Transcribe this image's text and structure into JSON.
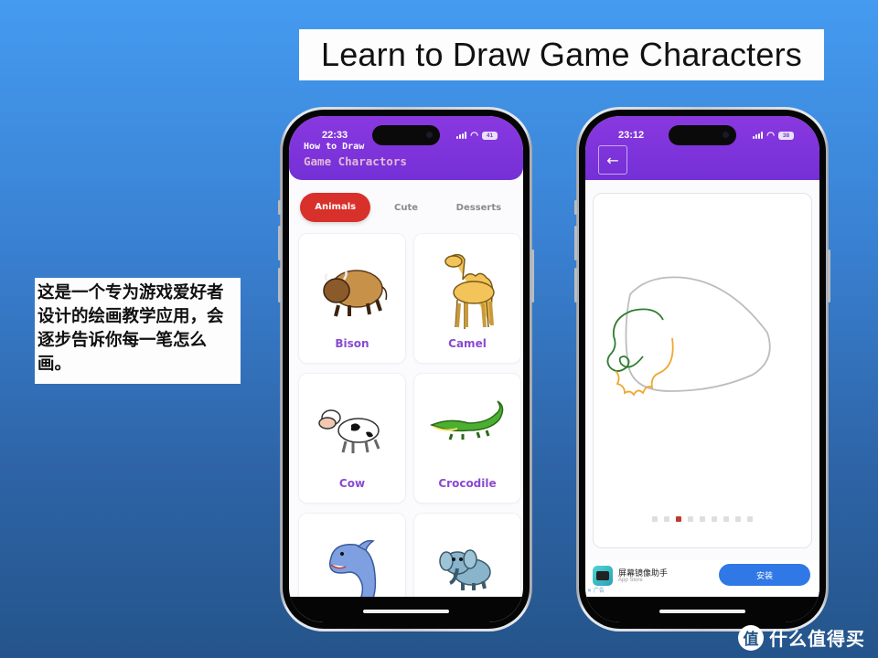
{
  "slide": {
    "title": "Learn to Draw Game Characters",
    "caption": "这是一个专为游戏爱好者设计的绘画教学应用，会逐步告诉你每一笔怎么画。",
    "watermark": {
      "logo_char": "值",
      "text": "什么值得买"
    }
  },
  "phone_left": {
    "status": {
      "time": "22:33",
      "battery": "41"
    },
    "header": {
      "subtitle": "How to Draw",
      "title": "Game Charactors"
    },
    "tabs": [
      {
        "label": "Animals",
        "active": true
      },
      {
        "label": "Cute",
        "active": false
      },
      {
        "label": "Desserts",
        "active": false
      }
    ],
    "cards": [
      {
        "name": "Bison",
        "icon": "bison-icon"
      },
      {
        "name": "Camel",
        "icon": "camel-icon"
      },
      {
        "name": "Cow",
        "icon": "cow-icon"
      },
      {
        "name": "Crocodile",
        "icon": "crocodile-icon"
      },
      {
        "name": "",
        "icon": "dolphin-icon"
      },
      {
        "name": "",
        "icon": "elephant-icon"
      }
    ]
  },
  "phone_right": {
    "status": {
      "time": "23:12",
      "battery": "38"
    },
    "back_icon": "←",
    "steps": {
      "total": 9,
      "current": 3
    },
    "ad": {
      "app_name": "屏幕镜像助手",
      "store": "App Store",
      "tag": "✕ 广告",
      "install_label": "安装"
    }
  },
  "colors": {
    "header_purple": "#7a34da",
    "active_tab": "#d8302a",
    "card_label": "#8a4ad0",
    "install_blue": "#2f78e6",
    "active_dot": "#c0392b",
    "stroke_outline": "#bdbdbd",
    "stroke_green": "#2e7d32",
    "stroke_orange": "#f0a830"
  }
}
